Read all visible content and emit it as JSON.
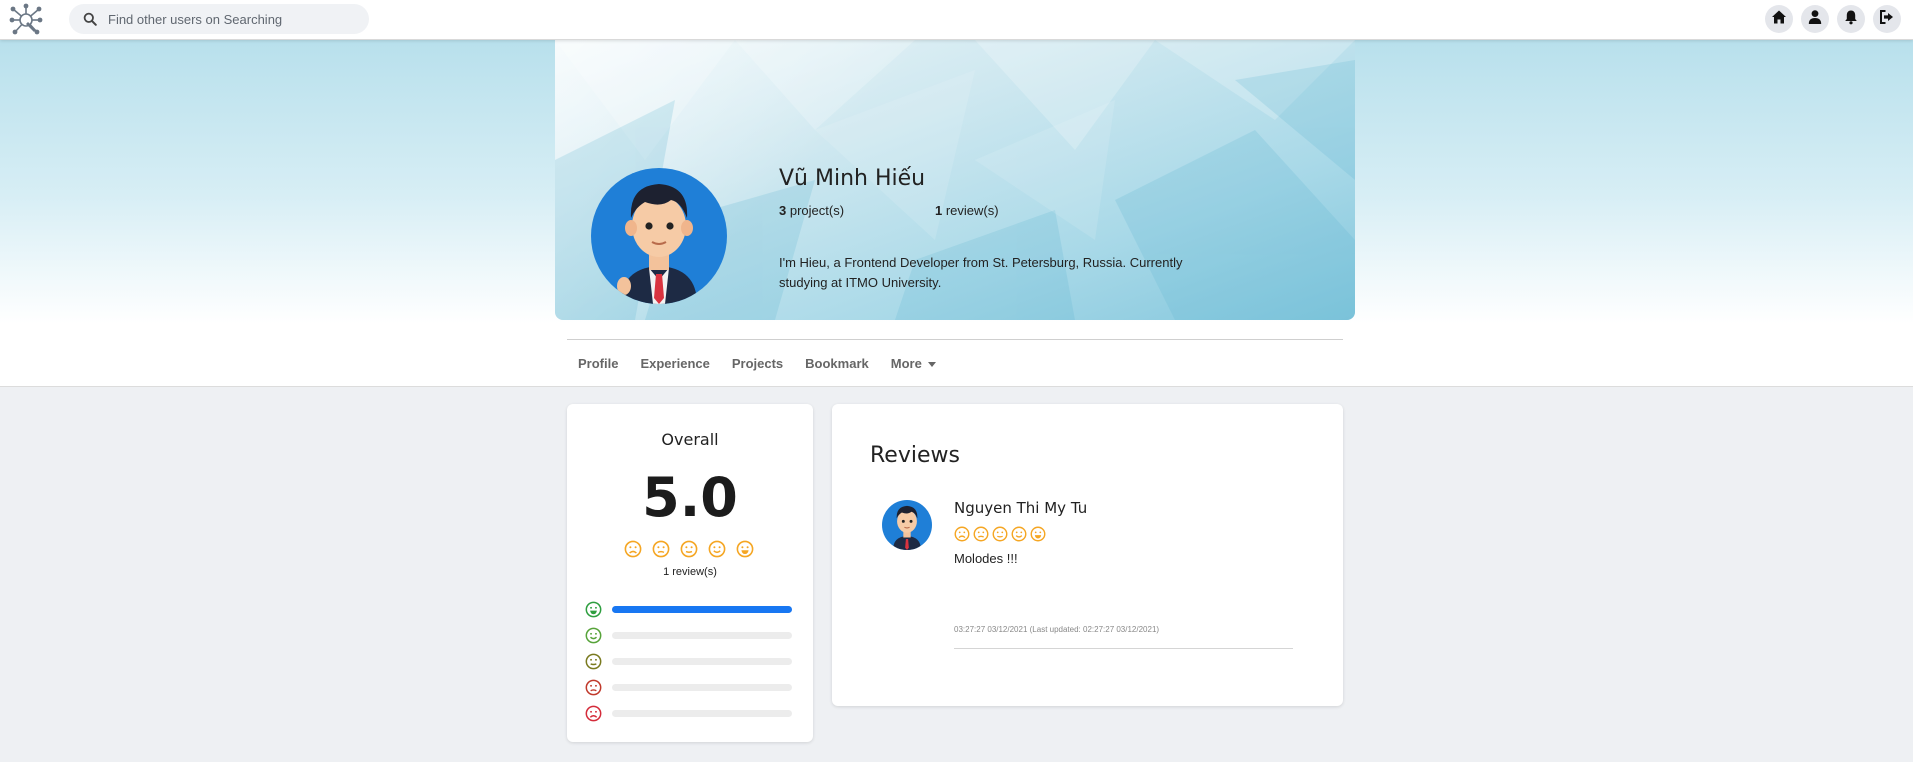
{
  "search": {
    "placeholder": "Find other users on Searching"
  },
  "nav": {
    "icons": [
      "home-icon",
      "user-icon",
      "bell-icon",
      "logout-icon"
    ]
  },
  "profile": {
    "name": "Vũ Minh Hiếu",
    "projects_count": "3",
    "projects_label": " project(s)",
    "reviews_count": "1",
    "reviews_label": " review(s)",
    "bio": "I'm Hieu, a Frontend Developer from St. Petersburg, Russia. Currently studying at ITMO University."
  },
  "tabs": [
    "Profile",
    "Experience",
    "Projects",
    "Bookmark",
    "More"
  ],
  "overall": {
    "title": "Overall",
    "score": "5.0",
    "review_count": "1 review(s)",
    "distribution": [
      {
        "level": 5,
        "fraction": 1.0,
        "color": "#2e9e3f"
      },
      {
        "level": 4,
        "fraction": 0.0,
        "color": "#57a33a"
      },
      {
        "level": 3,
        "fraction": 0.0,
        "color": "#7a7a1f"
      },
      {
        "level": 2,
        "fraction": 0.0,
        "color": "#c0392b"
      },
      {
        "level": 1,
        "fraction": 0.0,
        "color": "#d42b3a"
      }
    ]
  },
  "reviews": {
    "title": "Reviews",
    "items": [
      {
        "author": "Nguyen Thi My Tu",
        "rating": 5,
        "text": "Molodes !!!",
        "timestamp": "03:27:27 03/12/2021 (Last updated: 02:27:27 03/12/2021)"
      }
    ]
  },
  "colors": {
    "accent": "#1877f2",
    "rating_orange": "#f5a623"
  }
}
